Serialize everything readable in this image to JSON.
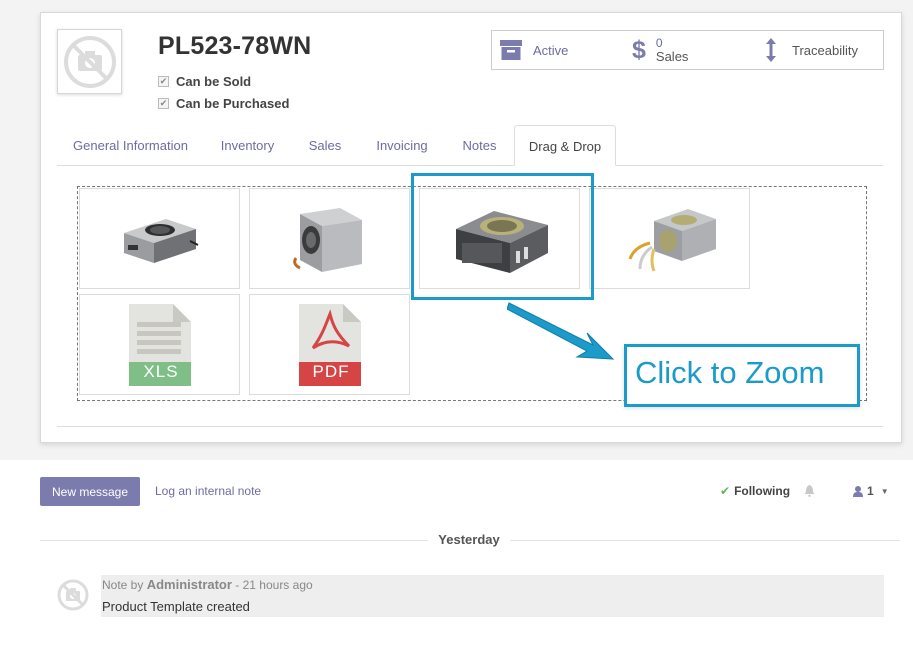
{
  "product": {
    "name": "PL523-78WN",
    "checks": [
      {
        "label": "Can be Sold",
        "checked": true
      },
      {
        "label": "Can be Purchased",
        "checked": true
      }
    ]
  },
  "stat_buttons": {
    "active": {
      "label": "Active",
      "icon": "archive-icon"
    },
    "sales": {
      "count": "0",
      "label": "Sales",
      "icon": "dollar-icon"
    },
    "traceability": {
      "label": "Traceability",
      "icon": "up-down-arrow-icon"
    }
  },
  "tabs": [
    "General Information",
    "Inventory",
    "Sales",
    "Invoicing",
    "Notes",
    "Drag & Drop"
  ],
  "active_tab": "Drag & Drop",
  "attachments": [
    {
      "kind": "image",
      "icon": "power-supply-image"
    },
    {
      "kind": "image",
      "icon": "power-supply-image"
    },
    {
      "kind": "image",
      "icon": "power-supply-image"
    },
    {
      "kind": "image",
      "icon": "power-supply-image"
    },
    {
      "kind": "file",
      "icon": "xls-file-icon",
      "label": "XLS"
    },
    {
      "kind": "file",
      "icon": "pdf-file-icon",
      "label": "PDF"
    }
  ],
  "callout": {
    "text": "Click to Zoom"
  },
  "chatter": {
    "new_message": "New message",
    "log_note": "Log an internal note",
    "following": "Following",
    "followers_count": "1",
    "date_separator": "Yesterday",
    "message": {
      "prefix": "Note by",
      "author": "Administrator",
      "time": "- 21 hours ago",
      "body": "Product Template created"
    }
  },
  "colors": {
    "accent": "#7c7bad",
    "callout": "#1b9bc9",
    "xls": "#7fbf87",
    "pdf": "#d64545"
  }
}
